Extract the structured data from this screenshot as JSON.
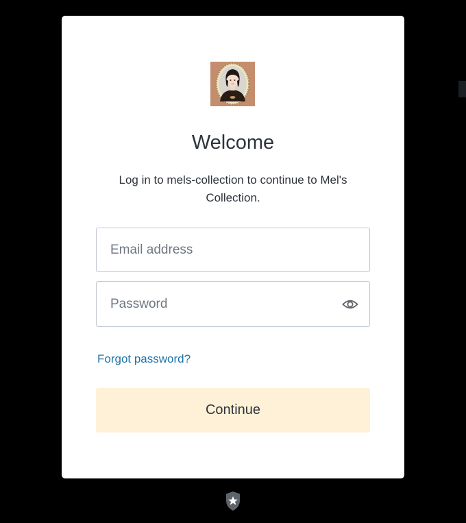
{
  "login": {
    "title": "Welcome",
    "subtitle": "Log in to mels-collection to continue to Mel's Collection.",
    "email_placeholder": "Email address",
    "password_placeholder": "Password",
    "forgot_password": "Forgot password?",
    "continue_label": "Continue"
  },
  "icons": {
    "logo": "portrait-logo",
    "show_password": "eye-icon",
    "footer": "shield-star-icon"
  },
  "colors": {
    "background": "#000000",
    "card": "#ffffff",
    "link": "#1f72a8",
    "button": "#fef1d8",
    "text": "#2d333a"
  }
}
